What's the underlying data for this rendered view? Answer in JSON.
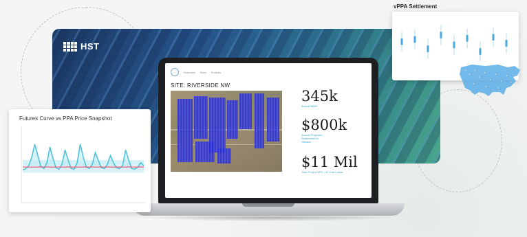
{
  "hero": {
    "logo_text": "HST",
    "colors": {
      "hero_start": "#1c3a66",
      "hero_end": "#4aa78c"
    }
  },
  "screen": {
    "nav": {
      "items": [
        "Overview",
        "Sites",
        "Portfolio"
      ],
      "right_link": "",
      "user": ""
    },
    "site_title": "SITE: RIVERSIDE NW",
    "stats": [
      {
        "value": "345k",
        "label": "Annual MWH"
      },
      {
        "value": "$800k",
        "label": "Annual Projected Settlement for Offtaker"
      },
      {
        "value": "$11 Mil",
        "label": "Total Project NPV / 20 Year Lease"
      }
    ]
  },
  "futures_card": {
    "title": "Futures Curve vs PPA Price Snapshot",
    "x_ticks": [
      "",
      "",
      ""
    ],
    "colors": {
      "futures": "#4fc3dc",
      "futures_fill": "#bfe9f2",
      "ppa": "#e05a7a",
      "band": "#7fd3e6"
    }
  },
  "vppa_card": {
    "title": "vPPA Settlement",
    "colors": {
      "accent": "#4aa7e0",
      "map": "#5aaee6"
    }
  },
  "chart_data": [
    {
      "type": "area",
      "title": "Futures Curve vs PPA Price Snapshot",
      "xlabel": "",
      "ylabel": "",
      "x": [
        0,
        1,
        2,
        3,
        4,
        5,
        6,
        7,
        8,
        9,
        10,
        11,
        12,
        13,
        14,
        15,
        16,
        17,
        18,
        19,
        20,
        21,
        22,
        23,
        24,
        25,
        26,
        27,
        28,
        29,
        30,
        31,
        32,
        33,
        34,
        35,
        36,
        37,
        38,
        39,
        40
      ],
      "series": [
        {
          "values": [
            42,
            44,
            48,
            60,
            78,
            62,
            47,
            44,
            52,
            74,
            58,
            45,
            43,
            50,
            70,
            56,
            44,
            43,
            52,
            78,
            60,
            46,
            44,
            50,
            66,
            55,
            45,
            44,
            50,
            62,
            52,
            45,
            44,
            48,
            70,
            56,
            44,
            43,
            46,
            52,
            48
          ]
        },
        {
          "values": [
            46,
            46,
            46,
            46,
            46,
            46,
            46,
            46,
            46,
            46,
            46,
            46,
            46,
            46,
            46,
            46,
            46,
            46,
            46,
            46,
            46,
            46,
            46,
            46,
            46,
            46,
            46,
            46,
            46,
            46,
            46,
            46,
            46,
            46,
            46,
            46,
            46,
            46,
            46,
            46,
            46
          ]
        }
      ],
      "ylim": [
        0,
        100
      ]
    },
    {
      "type": "scatter",
      "title": "vPPA Settlement",
      "categories": [
        "1",
        "2",
        "3",
        "4",
        "5",
        "6",
        "7",
        "8",
        "9"
      ],
      "series": [
        {
          "values": [
            58,
            62,
            45,
            70,
            52,
            64,
            40,
            66,
            55
          ]
        }
      ],
      "ylim": [
        0,
        100
      ]
    }
  ]
}
